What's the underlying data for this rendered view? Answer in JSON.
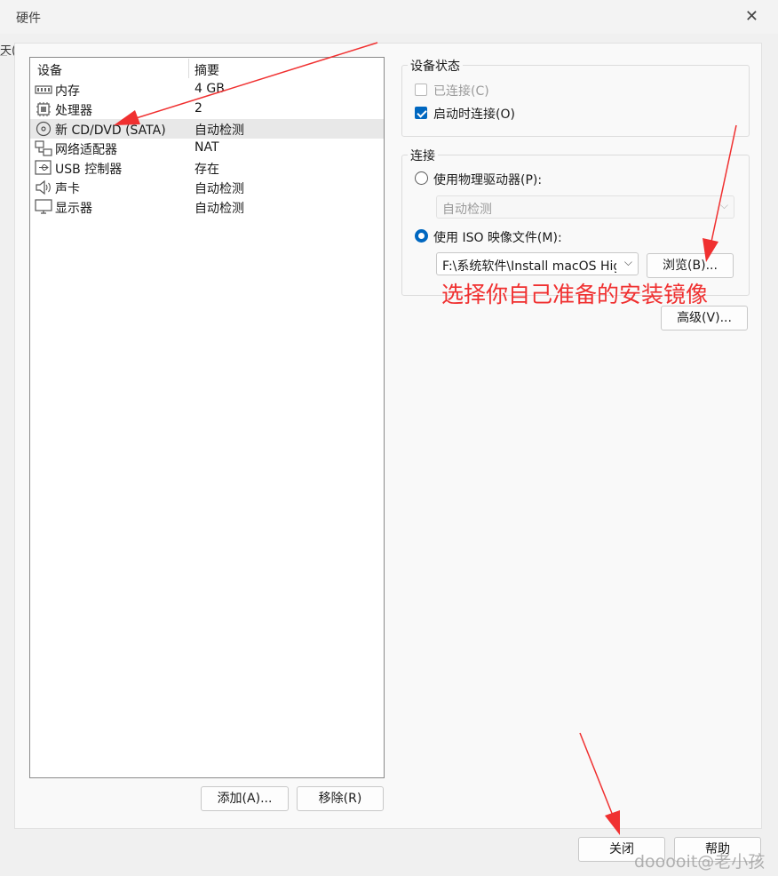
{
  "window": {
    "title": "硬件",
    "close_glyph": "✕"
  },
  "behind_text": "天(",
  "device_list": {
    "headers": {
      "device": "设备",
      "summary": "摘要"
    },
    "rows": [
      {
        "name": "内存",
        "summary": "4 GB",
        "icon": "memory-icon"
      },
      {
        "name": "处理器",
        "summary": "2",
        "icon": "processor-icon"
      },
      {
        "name": "新 CD/DVD (SATA)",
        "summary": "自动检测",
        "icon": "cd-dvd-icon",
        "selected": true
      },
      {
        "name": "网络适配器",
        "summary": "NAT",
        "icon": "network-adapter-icon"
      },
      {
        "name": "USB 控制器",
        "summary": "存在",
        "icon": "usb-icon"
      },
      {
        "name": "声卡",
        "summary": "自动检测",
        "icon": "sound-card-icon"
      },
      {
        "name": "显示器",
        "summary": "自动检测",
        "icon": "display-icon"
      }
    ]
  },
  "buttons": {
    "add": "添加(A)...",
    "remove": "移除(R)",
    "browse": "浏览(B)...",
    "advanced": "高级(V)...",
    "close": "关闭",
    "help": "帮助"
  },
  "device_status": {
    "title": "设备状态",
    "connected": {
      "label": "已连接(C)",
      "checked": false,
      "disabled": true
    },
    "connect_at_power_on": {
      "label": "启动时连接(O)",
      "checked": true
    }
  },
  "connection": {
    "title": "连接",
    "physical_drive": {
      "label": "使用物理驱动器(P):",
      "selected": false,
      "value": "自动检测"
    },
    "iso_image": {
      "label": "使用 ISO 映像文件(M):",
      "selected": true,
      "value": "F:\\系统软件\\Install macOS Hig"
    }
  },
  "annotation": "选择你自己准备的安装镜像",
  "watermark": "dooooit@老小孩",
  "colors": {
    "accent": "#0067c0",
    "annotation": "#f03030"
  }
}
